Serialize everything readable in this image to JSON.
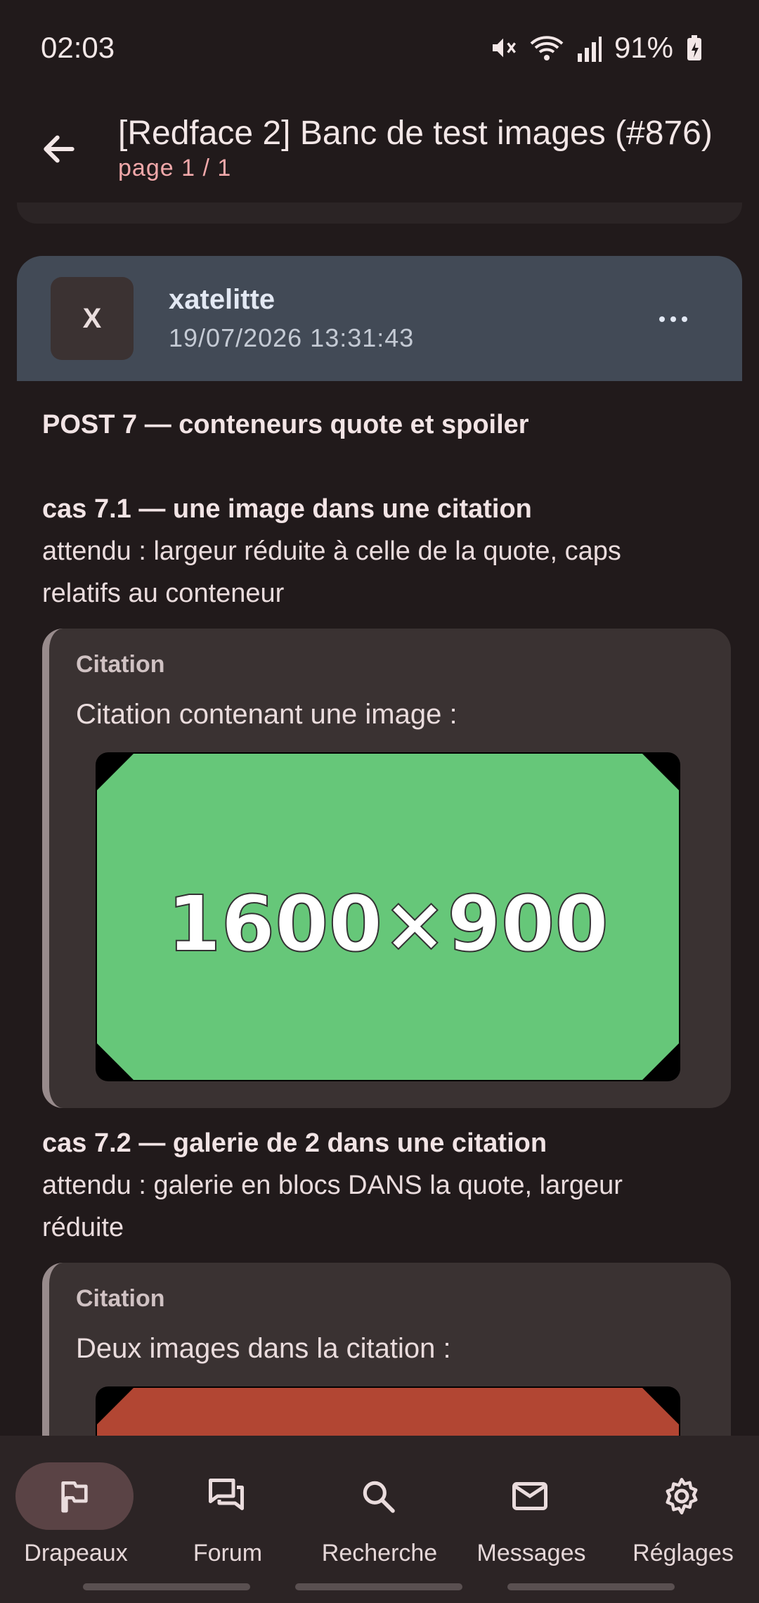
{
  "status": {
    "time": "02:03",
    "battery": "91%"
  },
  "appbar": {
    "title": "[Redface 2] Banc de test images (#876)",
    "subtitle": "page 1 / 1"
  },
  "post": {
    "avatar_letter": "X",
    "author": "xatelitte",
    "date": "19/07/2026 13:31:43",
    "title": "POST 7 — conteneurs quote et spoiler",
    "cases": [
      {
        "title": "cas 7.1 — une image dans une citation",
        "desc_line1": "attendu : largeur réduite à celle de la quote, caps",
        "desc_line2": "relatifs au conteneur",
        "quote_label": "Citation",
        "quote_text": "Citation contenant une image :",
        "image_text": "1600×900",
        "image_color": "#66c779"
      },
      {
        "title": "cas 7.2 — galerie de 2 dans une citation",
        "desc_line1": "attendu : galerie en blocs DANS la quote, largeur",
        "desc_line2": "réduite",
        "quote_label": "Citation",
        "quote_text": "Deux images dans la citation :",
        "image_color": "#b24633"
      }
    ]
  },
  "nav": [
    {
      "label": "Drapeaux",
      "icon": "flag-icon",
      "active": true
    },
    {
      "label": "Forum",
      "icon": "forum-icon",
      "active": false
    },
    {
      "label": "Recherche",
      "icon": "search-icon",
      "active": false
    },
    {
      "label": "Messages",
      "icon": "mail-icon",
      "active": false
    },
    {
      "label": "Réglages",
      "icon": "gear-icon",
      "active": false
    }
  ],
  "colors": {
    "background": "#211a1b",
    "header": "#424a56",
    "accent": "#f1a8aa",
    "quote": "#3a3232"
  }
}
